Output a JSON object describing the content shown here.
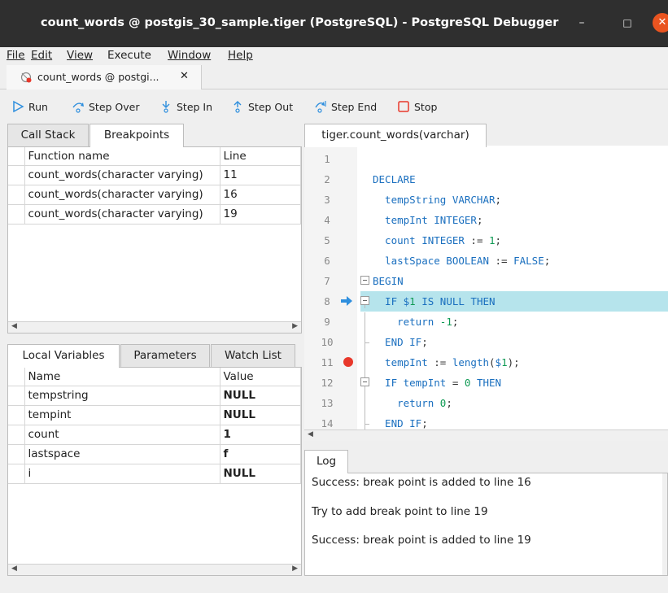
{
  "window": {
    "title": "count_words @ postgis_30_sample.tiger (PostgreSQL) - PostgreSQL Debugger",
    "minimize": "–",
    "maximize": "□",
    "close": "✕"
  },
  "menu": [
    "File",
    "Edit",
    "View",
    "Execute",
    "Window",
    "Help"
  ],
  "doc_tab": {
    "label": "count_words @ postgi...",
    "close": "✕"
  },
  "toolbar": {
    "run": "Run",
    "step_over": "Step Over",
    "step_in": "Step In",
    "step_out": "Step Out",
    "step_end": "Step End",
    "stop": "Stop"
  },
  "upper_left": {
    "tabs": [
      "Call Stack",
      "Breakpoints"
    ],
    "active_tab": "Breakpoints",
    "columns": [
      "Function name",
      "Line"
    ],
    "rows": [
      {
        "function": "count_words(character varying)",
        "line": "11"
      },
      {
        "function": "count_words(character varying)",
        "line": "16"
      },
      {
        "function": "count_words(character varying)",
        "line": "19"
      }
    ]
  },
  "lower_left": {
    "tabs": [
      "Local Variables",
      "Parameters",
      "Watch List"
    ],
    "active_tab": "Local Variables",
    "columns": [
      "Name",
      "Value"
    ],
    "rows": [
      {
        "name": "tempstring",
        "value": "NULL"
      },
      {
        "name": "tempint",
        "value": "NULL"
      },
      {
        "name": "count",
        "value": "1"
      },
      {
        "name": "lastspace",
        "value": "f"
      },
      {
        "name": "i",
        "value": "NULL"
      }
    ]
  },
  "editor": {
    "tab": "tiger.count_words(varchar)",
    "current_line": 8,
    "breakpoint_lines": [
      11
    ],
    "lines": [
      {
        "n": "1",
        "code": ""
      },
      {
        "n": "2",
        "code": "DECLARE"
      },
      {
        "n": "3",
        "code": "  tempString VARCHAR;"
      },
      {
        "n": "4",
        "code": "  tempInt INTEGER;"
      },
      {
        "n": "5",
        "code": "  count INTEGER := 1;"
      },
      {
        "n": "6",
        "code": "  lastSpace BOOLEAN := FALSE;"
      },
      {
        "n": "7",
        "code": "BEGIN"
      },
      {
        "n": "8",
        "code": "  IF $1 IS NULL THEN"
      },
      {
        "n": "9",
        "code": "    return -1;"
      },
      {
        "n": "10",
        "code": "  END IF;"
      },
      {
        "n": "11",
        "code": "  tempInt := length($1);"
      },
      {
        "n": "12",
        "code": "  IF tempInt = 0 THEN"
      },
      {
        "n": "13",
        "code": "    return 0;"
      },
      {
        "n": "14",
        "code": "  END IF;"
      }
    ]
  },
  "log": {
    "tab": "Log",
    "lines": [
      "Success: break point is added to line 16",
      "Try to add break point to line 19",
      "Success: break point is added to line 19"
    ]
  },
  "colors": {
    "titlebar": "#2f2f2f",
    "close_button": "#e95420",
    "highlight": "#b6e4ec",
    "keyword": "#1a6fbf",
    "number": "#0f9a54",
    "breakpoint": "#e8382b",
    "arrow": "#2f8fde"
  }
}
